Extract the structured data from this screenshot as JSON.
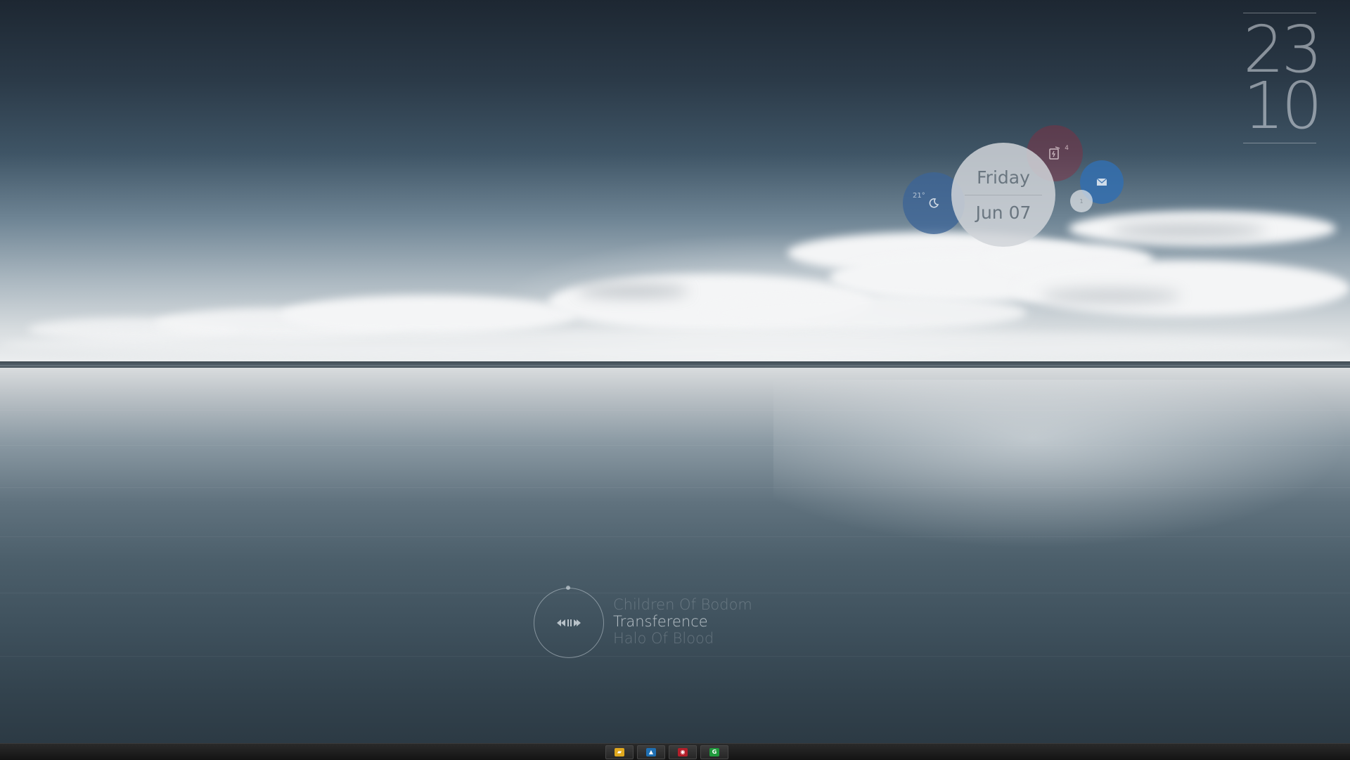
{
  "clock": {
    "hours": "23",
    "minutes": "10"
  },
  "widget": {
    "day": "Friday",
    "date": "Jun 07",
    "weather_temp": "21°",
    "flash_count": "4",
    "small_count": "1"
  },
  "music": {
    "artist": "Children Of Bodom",
    "title": "Transference",
    "album": "Halo Of Blood",
    "controls_icon": "prev-pause-next-icon"
  },
  "taskbar": {
    "apps": [
      {
        "name": "file-explorer-icon",
        "color": "#e0a81e",
        "glyph": "▰"
      },
      {
        "name": "app-blue-icon",
        "color": "#1f6fb2",
        "glyph": "▲"
      },
      {
        "name": "app-red-icon",
        "color": "#b21f2a",
        "glyph": "◉"
      },
      {
        "name": "app-green-icon",
        "color": "#1f9a3c",
        "glyph": "G"
      }
    ]
  }
}
